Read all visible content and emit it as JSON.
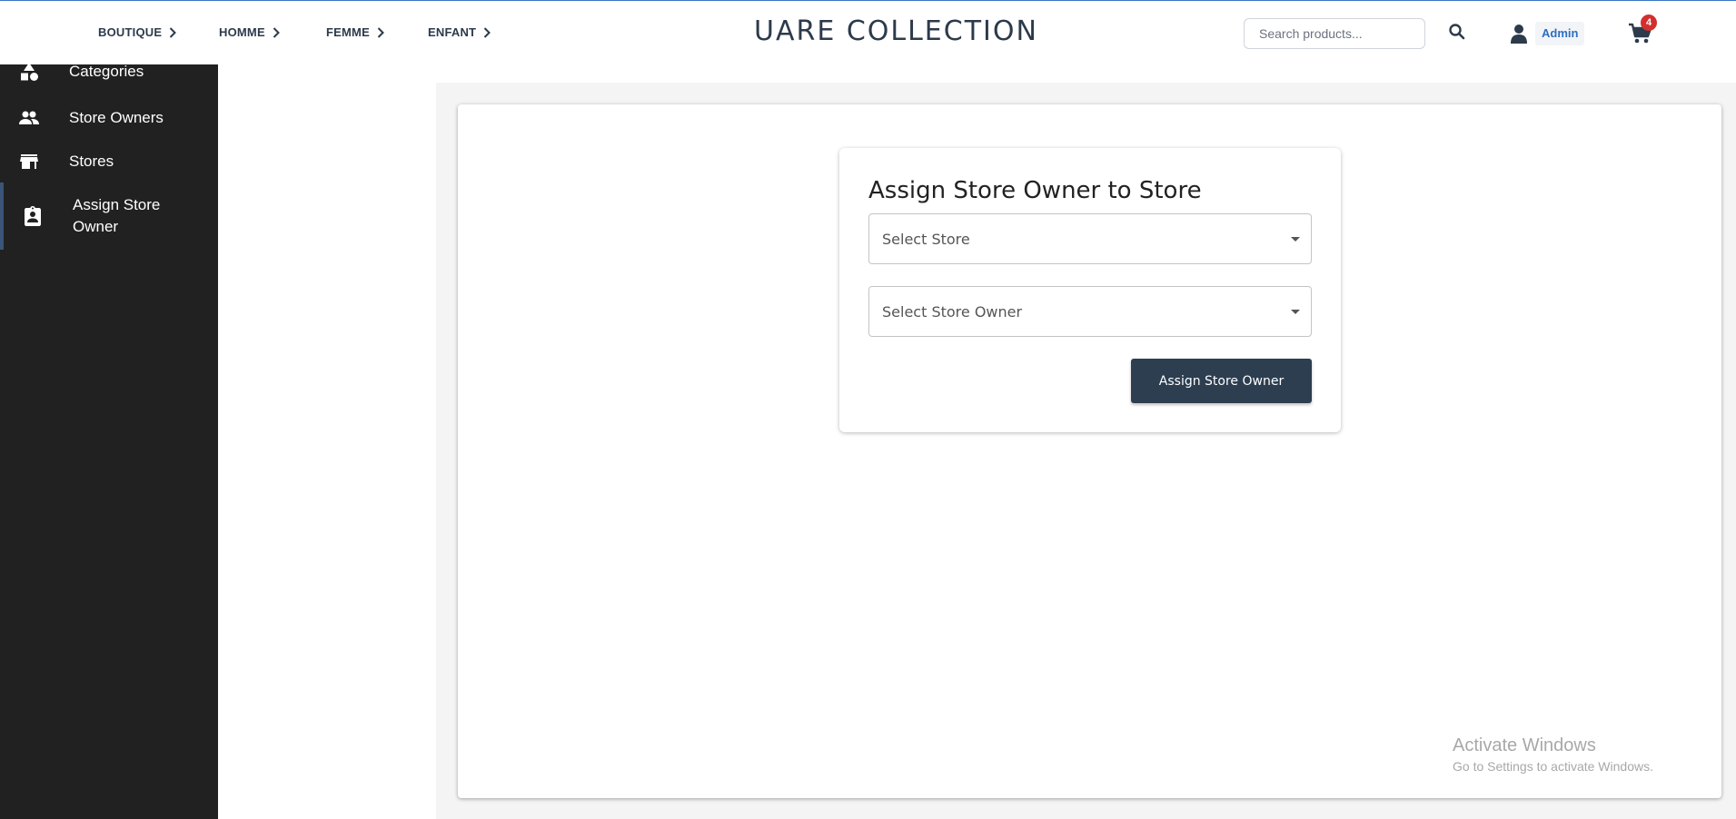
{
  "nav": {
    "items": [
      {
        "label": "BOUTIQUE"
      },
      {
        "label": "HOMME"
      },
      {
        "label": "FEMME"
      },
      {
        "label": "ENFANT"
      }
    ]
  },
  "brand": "UARE COLLECTION",
  "search": {
    "placeholder": "Search products...",
    "value": ""
  },
  "user": {
    "label": "Admin"
  },
  "cart": {
    "count": "4"
  },
  "sidebar": {
    "items": [
      {
        "label": "Categories",
        "icon": "shapes-icon"
      },
      {
        "label": "Store Owners",
        "icon": "people-icon"
      },
      {
        "label": "Stores",
        "icon": "store-icon"
      },
      {
        "label": "Assign Store Owner",
        "icon": "assignment-ind-icon",
        "active": true
      }
    ]
  },
  "form": {
    "title": "Assign Store Owner to Store",
    "store_placeholder": "Select Store",
    "owner_placeholder": "Select Store Owner",
    "submit_label": "Assign Store Owner"
  },
  "watermark": {
    "line1": "Activate Windows",
    "line2": "Go to Settings to activate Windows."
  },
  "colors": {
    "sidebar_bg": "#212121",
    "primary_button": "#2c3e50",
    "accent_link": "#2d6fbf",
    "badge": "#d32f2f"
  }
}
